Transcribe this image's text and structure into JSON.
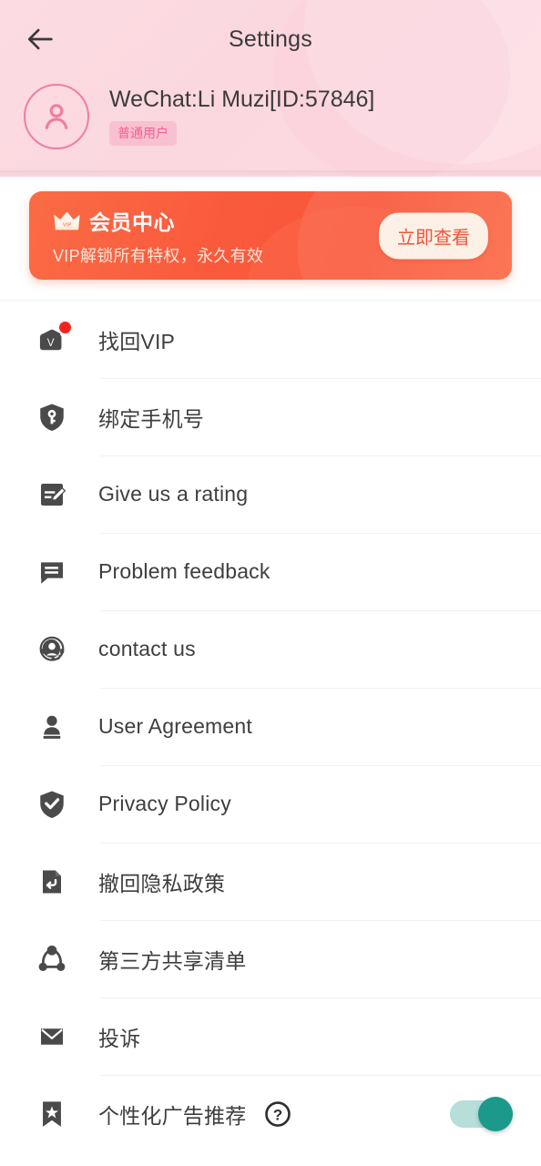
{
  "header": {
    "back_icon": "back-arrow-icon",
    "title": "Settings",
    "avatar_icon": "user-avatar-icon",
    "profile_name": "WeChat:Li Muzi[ID:57846]",
    "badge_label": "普通用户",
    "bg_color": "#fcdbe2",
    "accent_color": "#ef7f9d"
  },
  "banner": {
    "icon": "crown-vip-icon",
    "title": "会员中心",
    "subtitle": "VIP解锁所有特权，永久有效",
    "button_label": "立即查看",
    "bg_color": "#fa5a3c",
    "button_bg": "#fdf0e6",
    "button_text_color": "#f1543a"
  },
  "list": {
    "items": [
      {
        "icon": "wallet-vip-icon",
        "label": "找回VIP",
        "badge": true
      },
      {
        "icon": "shield-key-icon",
        "label": "绑定手机号",
        "badge": false
      },
      {
        "icon": "edit-document-icon",
        "label": "Give us a rating",
        "badge": false
      },
      {
        "icon": "chat-bubble-icon",
        "label": "Problem feedback",
        "badge": false
      },
      {
        "icon": "headset-support-icon",
        "label": "contact us",
        "badge": false
      },
      {
        "icon": "user-stamp-icon",
        "label": "User Agreement",
        "badge": false
      },
      {
        "icon": "shield-check-icon",
        "label": "Privacy Policy",
        "badge": false
      },
      {
        "icon": "revoke-return-icon",
        "label": "撤回隐私政策",
        "badge": false
      },
      {
        "icon": "share-nodes-icon",
        "label": "第三方共享清单",
        "badge": false
      },
      {
        "icon": "envelope-icon",
        "label": "投诉",
        "badge": false
      },
      {
        "icon": "bookmark-star-icon",
        "label": "个性化广告推荐",
        "badge": false,
        "help": "help-circle-icon",
        "toggle": "on"
      }
    ],
    "toggle_on_color": "#1b998b",
    "toggle_track_color": "#b7ded9",
    "icon_color": "#4a4a4a",
    "badge_dot_color": "#f5231e"
  }
}
